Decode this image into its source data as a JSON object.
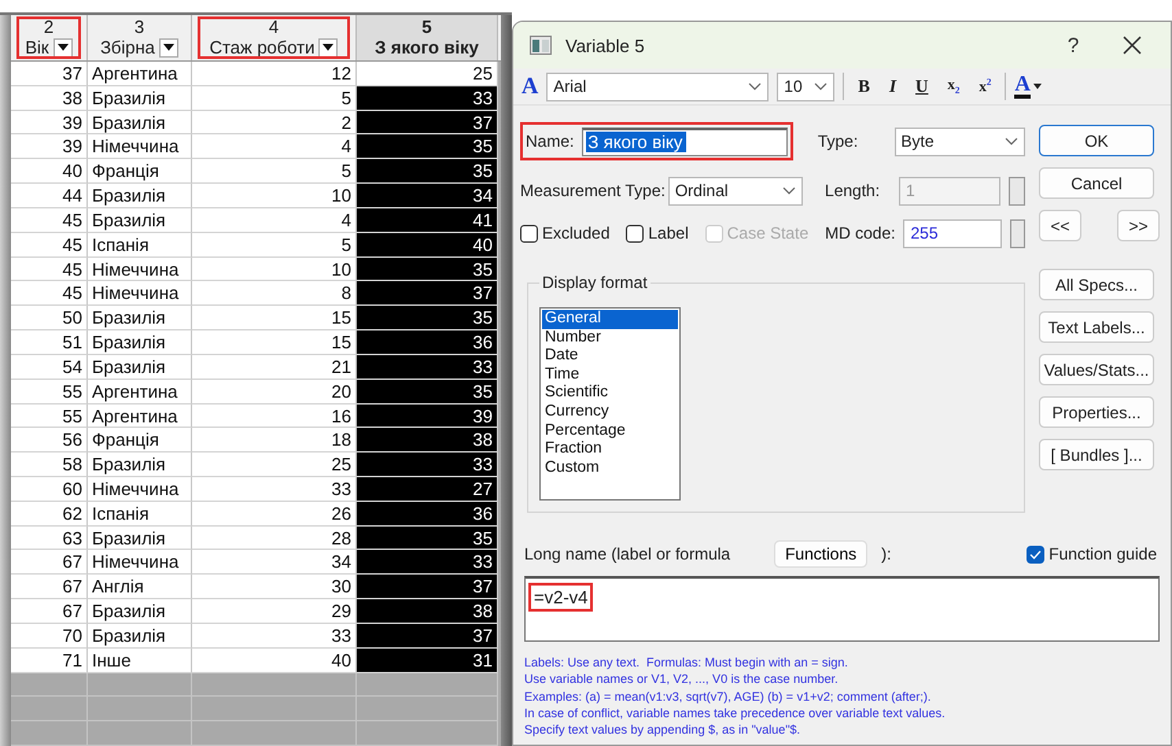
{
  "sheet": {
    "columns": [
      {
        "number": "2",
        "label": "Вік",
        "dropdown": true,
        "highlighted": true,
        "selected": false
      },
      {
        "number": "3",
        "label": "Збірна",
        "dropdown": true,
        "highlighted": false,
        "selected": false
      },
      {
        "number": "4",
        "label": "Стаж роботи",
        "dropdown": true,
        "highlighted": true,
        "selected": false
      },
      {
        "number": "5",
        "label": "З якого віку",
        "dropdown": false,
        "highlighted": false,
        "selected": true
      }
    ],
    "rows": [
      {
        "cells": [
          "37",
          "Аргентина",
          "12",
          "25"
        ],
        "selected": false
      },
      {
        "cells": [
          "38",
          "Бразилія",
          "5",
          "33"
        ],
        "selected": true
      },
      {
        "cells": [
          "39",
          "Бразилія",
          "2",
          "37"
        ],
        "selected": true
      },
      {
        "cells": [
          "39",
          "Німеччина",
          "4",
          "35"
        ],
        "selected": true
      },
      {
        "cells": [
          "40",
          "Франція",
          "5",
          "35"
        ],
        "selected": true
      },
      {
        "cells": [
          "44",
          "Бразилія",
          "10",
          "34"
        ],
        "selected": true
      },
      {
        "cells": [
          "45",
          "Бразилія",
          "4",
          "41"
        ],
        "selected": true
      },
      {
        "cells": [
          "45",
          "Іспанія",
          "5",
          "40"
        ],
        "selected": true
      },
      {
        "cells": [
          "45",
          "Німеччина",
          "10",
          "35"
        ],
        "selected": true
      },
      {
        "cells": [
          "45",
          "Німеччина",
          "8",
          "37"
        ],
        "selected": true
      },
      {
        "cells": [
          "50",
          "Бразилія",
          "15",
          "35"
        ],
        "selected": true
      },
      {
        "cells": [
          "51",
          "Бразилія",
          "15",
          "36"
        ],
        "selected": true
      },
      {
        "cells": [
          "54",
          "Бразилія",
          "21",
          "33"
        ],
        "selected": true
      },
      {
        "cells": [
          "55",
          "Аргентина",
          "20",
          "35"
        ],
        "selected": true
      },
      {
        "cells": [
          "55",
          "Аргентина",
          "16",
          "39"
        ],
        "selected": true
      },
      {
        "cells": [
          "56",
          "Франція",
          "18",
          "38"
        ],
        "selected": true
      },
      {
        "cells": [
          "58",
          "Бразилія",
          "25",
          "33"
        ],
        "selected": true
      },
      {
        "cells": [
          "60",
          "Німеччина",
          "33",
          "27"
        ],
        "selected": true
      },
      {
        "cells": [
          "62",
          "Іспанія",
          "26",
          "36"
        ],
        "selected": true
      },
      {
        "cells": [
          "63",
          "Бразилія",
          "28",
          "35"
        ],
        "selected": true
      },
      {
        "cells": [
          "67",
          "Німеччина",
          "34",
          "33"
        ],
        "selected": true
      },
      {
        "cells": [
          "67",
          "Англія",
          "30",
          "37"
        ],
        "selected": true
      },
      {
        "cells": [
          "67",
          "Бразилія",
          "29",
          "38"
        ],
        "selected": true
      },
      {
        "cells": [
          "70",
          "Бразилія",
          "33",
          "37"
        ],
        "selected": true
      },
      {
        "cells": [
          "71",
          "Інше",
          "40",
          "31"
        ],
        "selected": true
      }
    ]
  },
  "dialog": {
    "title": "Variable 5",
    "help": "?",
    "toolbar": {
      "font_icon": "A",
      "font": "Arial",
      "size": "10",
      "format_buttons": [
        {
          "label": "B",
          "kind": "bold"
        },
        {
          "label": "I",
          "kind": "italic"
        },
        {
          "label": "U",
          "kind": "underline"
        },
        {
          "label": "x$_{2}$",
          "kind": "subscript"
        },
        {
          "label": "x$^{2}$",
          "kind": "superscript"
        }
      ],
      "color_button": "A"
    },
    "name": {
      "label": "Name:",
      "value": "З якого віку",
      "highlighted": true
    },
    "type": {
      "label": "Type:",
      "value": "Byte"
    },
    "measurement": {
      "label": "Measurement Type:",
      "value": "Ordinal"
    },
    "length": {
      "label": "Length:",
      "value": "1",
      "disabled": true
    },
    "md_code": {
      "label": "MD code:",
      "value": "255"
    },
    "checkboxes": [
      {
        "label": "Excluded",
        "checked": false,
        "disabled": false
      },
      {
        "label": "Label",
        "checked": false,
        "disabled": false
      },
      {
        "label": "Case State",
        "checked": false,
        "disabled": true
      }
    ],
    "display_format": {
      "title": "Display format",
      "items": [
        {
          "label": "General",
          "selected": true
        },
        {
          "label": "Number",
          "selected": false
        },
        {
          "label": "Date",
          "selected": false
        },
        {
          "label": "Time",
          "selected": false
        },
        {
          "label": "Scientific",
          "selected": false
        },
        {
          "label": "Currency",
          "selected": false
        },
        {
          "label": "Percentage",
          "selected": false
        },
        {
          "label": "Fraction",
          "selected": false
        },
        {
          "label": "Custom",
          "selected": false
        }
      ]
    },
    "long_name": {
      "label": "Long name (label or formula",
      "functions_button": "Functions",
      "label_end": "):",
      "function_guide": {
        "label": "Function guide",
        "checked": true
      },
      "formula": "=v2-v4",
      "highlighted": true
    },
    "help_lines": [
      "Labels: Use any text.  Formulas: Must begin with an = sign.",
      "Use variable names or V1, V2, ..., V0 is the case number.",
      "Examples: (a) = mean(v1:v3, sqrt(v7), AGE) (b) = v1+v2; comment (after;).",
      "In case of conflict, variable names take precedence over variable text values.",
      "Specify text values by appending $, as in \"value\"$."
    ],
    "buttons": [
      {
        "label": "OK",
        "kind": "default"
      },
      {
        "label": "Cancel",
        "kind": "normal"
      },
      {
        "label": "<<",
        "kind": "nav"
      },
      {
        "label": ">>",
        "kind": "nav"
      },
      {
        "label": "All Specs...",
        "kind": "normal"
      },
      {
        "label": "Text Labels...",
        "kind": "normal"
      },
      {
        "label": "Values/Stats...",
        "kind": "normal"
      },
      {
        "label": "Properties...",
        "kind": "normal"
      },
      {
        "label": "[ Bundles ]...",
        "kind": "normal"
      }
    ]
  }
}
